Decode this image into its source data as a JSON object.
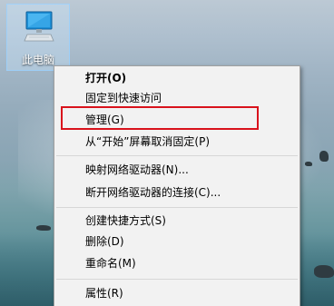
{
  "desktop": {
    "icon": {
      "name": "computer-icon",
      "label": "此电脑"
    }
  },
  "context_menu": {
    "items": [
      {
        "label": "打开(O)",
        "bold": true
      },
      {
        "label": "固定到快速访问"
      },
      {
        "label": "管理(G)",
        "highlighted": true
      },
      {
        "label": "从“开始”屏幕取消固定(P)"
      },
      {
        "label": "映射网络驱动器(N)..."
      },
      {
        "label": "断开网络驱动器的连接(C)..."
      },
      {
        "label": "创建快捷方式(S)"
      },
      {
        "label": "删除(D)"
      },
      {
        "label": "重命名(M)"
      },
      {
        "label": "属性(R)"
      }
    ],
    "highlight_color": "#d9121c"
  }
}
